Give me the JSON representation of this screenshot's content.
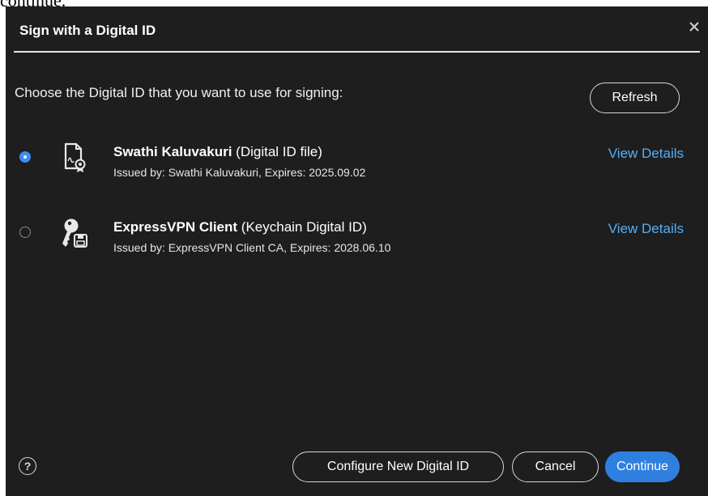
{
  "behind_text": "continue.",
  "dialog": {
    "title": "Sign with a Digital ID",
    "close_glyph": "×",
    "prompt": "Choose the Digital ID that you want to use for signing:",
    "refresh_label": "Refresh"
  },
  "ids": [
    {
      "name": "Swathi Kaluvakuri",
      "type": " (Digital ID file)",
      "issued": "Issued by: Swathi Kaluvakuri, Expires: 2025.09.02",
      "details_label": "View Details",
      "selected": true,
      "icon": "certificate-file-icon"
    },
    {
      "name": "ExpressVPN Client",
      "type": " (Keychain Digital ID)",
      "issued": "Issued by: ExpressVPN Client CA, Expires: 2028.06.10",
      "details_label": "View Details",
      "selected": false,
      "icon": "key-keychain-icon"
    }
  ],
  "footer": {
    "help_glyph": "?",
    "configure_label": "Configure New Digital ID",
    "cancel_label": "Cancel",
    "continue_label": "Continue"
  },
  "colors": {
    "background": "#1e1e1e",
    "accent": "#2f7fe0",
    "link": "#56aef5"
  }
}
